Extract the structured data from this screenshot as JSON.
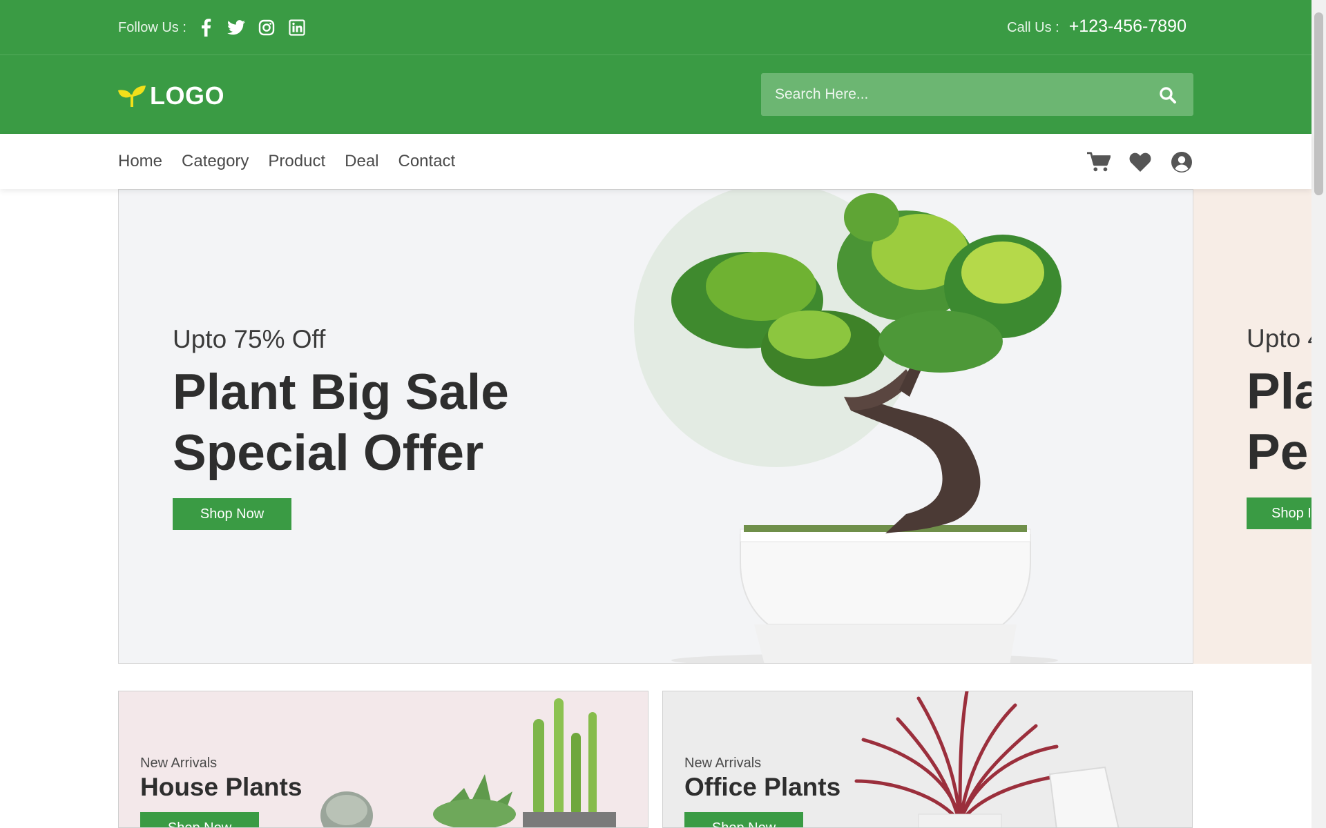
{
  "topbar": {
    "follow_label": "Follow Us :",
    "social_icons": [
      "facebook-icon",
      "twitter-icon",
      "instagram-icon",
      "linkedin-icon"
    ],
    "call_label": "Call Us :",
    "call_number": "+123-456-7890"
  },
  "header": {
    "logo_text": "LOGO",
    "search_placeholder": "Search Here...",
    "search_value": ""
  },
  "nav": {
    "links": [
      "Home",
      "Category",
      "Product",
      "Deal",
      "Contact"
    ],
    "icons": [
      "cart-icon",
      "heart-icon",
      "user-icon"
    ]
  },
  "hero": {
    "subtitle": "Upto 75% Off",
    "title_line1": "Plant Big Sale",
    "title_line2": "Special Offer",
    "button": "Shop Now"
  },
  "hero_next": {
    "subtitle": "Upto 4",
    "title_line1": "Pla",
    "title_line2": "Pe",
    "button": "Shop I"
  },
  "cards": [
    {
      "subtitle": "New Arrivals",
      "title": "House Plants",
      "button": "Shop Now"
    },
    {
      "subtitle": "New Arrivals",
      "title": "Office Plants",
      "button": "Shop Now"
    }
  ],
  "colors": {
    "brand_green": "#3a9b44",
    "search_bg": "#6cb672",
    "logo_accent": "#f2e01a",
    "text_dark": "#2e2e2e"
  }
}
